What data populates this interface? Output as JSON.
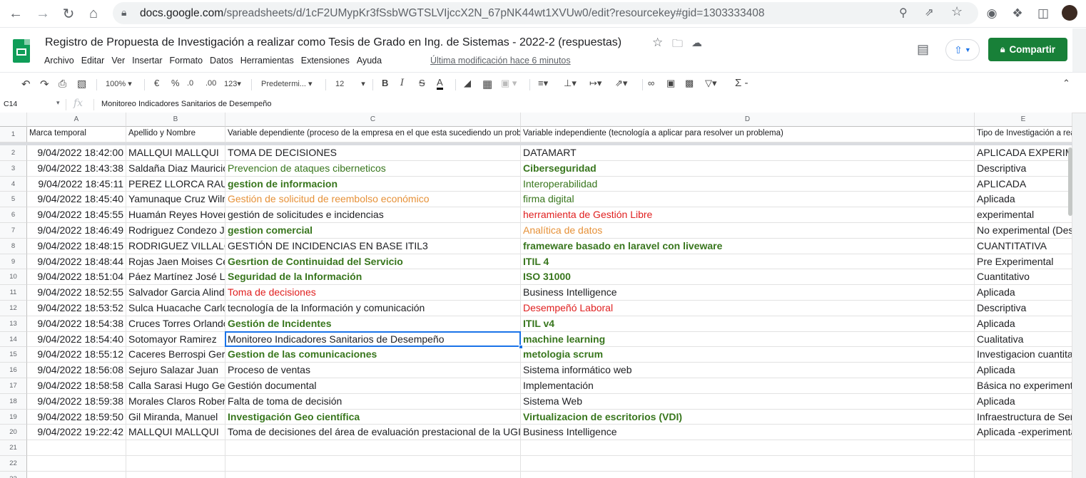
{
  "browser": {
    "url_host": "docs.google.com",
    "url_path": "/spreadsheets/d/1cF2UMypKr3fSsbWGTSLVIjccX2N_67pNK44wt1XVUw0/",
    "url_tail": "edit?resourcekey#gid=1303333408"
  },
  "doc": {
    "title": "Registro de Propuesta de Investigación a realizar como Tesis de Grado en Ing. de Sistemas - 2022-2 (respuestas)",
    "menu": [
      "Archivo",
      "Editar",
      "Ver",
      "Insertar",
      "Formato",
      "Datos",
      "Herramientas",
      "Extensiones",
      "Ayuda"
    ],
    "last_edit": "Última modificación hace 6 minutos",
    "share_label": "Compartir"
  },
  "toolbar": {
    "zoom": "100%",
    "currency": "€",
    "percent": "%",
    "dec_less": ".0",
    "dec_more": ".00",
    "format_more": "123",
    "font": "Predetermi...",
    "font_size": "12",
    "bold": "B",
    "italic": "I",
    "strike": "S",
    "text_color": "A",
    "sum": "Σ"
  },
  "formula": {
    "cell_ref": "C14",
    "fx": "fx",
    "content": "Monitoreo  Indicadores Sanitarios de Desempeño"
  },
  "columns": [
    "A",
    "B",
    "C",
    "D",
    "E"
  ],
  "header_row": [
    "Marca temporal",
    "Apellido y Nombre",
    "Variable dependiente (proceso de la empresa en el que esta sucediendo un problema)",
    "Variable independiente (tecnología a aplicar para resolver un problema)",
    "Tipo de Investigación a realizar"
  ],
  "rows": [
    {
      "n": "2",
      "a": "9/04/2022 18:42:00",
      "b": "MALLQUI MALLQUI",
      "c": "TOMA DE DECISIONES",
      "cs": "",
      "d": "DATAMART",
      "ds": "",
      "e": "APLICADA EXPERIMENTAL"
    },
    {
      "n": "3",
      "a": "9/04/2022 18:43:38",
      "b": "Saldaña Diaz Mauricio",
      "c": "Prevencion de ataques ciberneticos",
      "cs": "greenN",
      "d": "Ciberseguridad",
      "ds": "green",
      "e": "Descriptiva"
    },
    {
      "n": "4",
      "a": "9/04/2022 18:45:11",
      "b": "PEREZ LLORCA RAUL",
      "c": "gestion de informacion",
      "cs": "green",
      "d": "Interoperabilidad",
      "ds": "greenN",
      "e": "APLICADA"
    },
    {
      "n": "5",
      "a": "9/04/2022 18:45:40",
      "b": "Yamunaque Cruz Wilmer",
      "c": "Gestión de solicitud de reembolso económico",
      "cs": "orange",
      "d": "firma digital",
      "ds": "greenN",
      "e": "Aplicada"
    },
    {
      "n": "6",
      "a": "9/04/2022 18:45:55",
      "b": "Huamán Reyes Hover",
      "c": "gestión de solicitudes e incidencias",
      "cs": "",
      "d": "herramienta de Gestión Libre",
      "ds": "red",
      "e": "experimental"
    },
    {
      "n": "7",
      "a": "9/04/2022 18:46:49",
      "b": "Rodriguez Condezo Jose",
      "c": "gestion comercial",
      "cs": "green",
      "d": "Analítica de datos",
      "ds": "orange",
      "e": "No experimental (Descriptiva)"
    },
    {
      "n": "8",
      "a": "9/04/2022 18:48:15",
      "b": "RODRIGUEZ VILLALOBOS",
      "c": "GESTIÓN DE INCIDENCIAS EN BASE ITIL3",
      "cs": "",
      "d": "frameware basado en laravel con liveware",
      "ds": "green",
      "e": "CUANTITATIVA"
    },
    {
      "n": "9",
      "a": "9/04/2022 18:48:44",
      "b": "Rojas Jaen Moises Cesar",
      "c": "Gesrtion de Continuidad del Servicio",
      "cs": "green",
      "d": "ITIL 4",
      "ds": "green",
      "e": "Pre Experimental"
    },
    {
      "n": "10",
      "a": "9/04/2022 18:51:04",
      "b": "Páez Martínez José Luis",
      "c": "Seguridad de la Información",
      "cs": "green",
      "d": "ISO 31000",
      "ds": "green",
      "e": "Cuantitativo"
    },
    {
      "n": "11",
      "a": "9/04/2022 18:52:55",
      "b": "Salvador Garcia Alindor",
      "c": "Toma de decisiones",
      "cs": "red",
      "d": "Business Intelligence",
      "ds": "",
      "e": "Aplicada"
    },
    {
      "n": "12",
      "a": "9/04/2022 18:53:52",
      "b": "Sulca Huacache Carlos",
      "c": "tecnología de la Información y comunicación",
      "cs": "",
      "d": "Desempeñó Laboral",
      "ds": "red",
      "e": "Descriptiva"
    },
    {
      "n": "13",
      "a": "9/04/2022 18:54:38",
      "b": "Cruces Torres Orlando",
      "c": "Gestión de Incidentes",
      "cs": "green",
      "d": "ITIL v4",
      "ds": "green",
      "e": "Aplicada"
    },
    {
      "n": "14",
      "a": "9/04/2022 18:54:40",
      "b": "Sotomayor Ramirez",
      "c": "Monitoreo  Indicadores Sanitarios de Desempeño",
      "cs": "",
      "d": "machine learning",
      "ds": "green",
      "e": "Cualitativa"
    },
    {
      "n": "15",
      "a": "9/04/2022 18:55:12",
      "b": "Caceres Berrospi Gerson",
      "c": "Gestion de las comunicaciones",
      "cs": "green",
      "d": "metologia scrum",
      "ds": "green",
      "e": "Investigacion cuantitativa"
    },
    {
      "n": "16",
      "a": "9/04/2022 18:56:08",
      "b": "Sejuro Salazar Juan",
      "c": "Proceso de ventas",
      "cs": "",
      "d": "Sistema informático web",
      "ds": "",
      "e": "Aplicada"
    },
    {
      "n": "17",
      "a": "9/04/2022 18:58:58",
      "b": "Calla Sarasi Hugo Gerson",
      "c": "Gestión documental",
      "cs": "",
      "d": "Implementación",
      "ds": "",
      "e": "Básica no experimental"
    },
    {
      "n": "18",
      "a": "9/04/2022 18:59:38",
      "b": "Morales Claros Roberto",
      "c": "Falta de toma de decisión",
      "cs": "",
      "d": "Sistema Web",
      "ds": "",
      "e": "Aplicada"
    },
    {
      "n": "19",
      "a": "9/04/2022 18:59:50",
      "b": "Gil Miranda, Manuel",
      "c": "Investigación Geo científica",
      "cs": "green",
      "d": "Virtualizacion de escritorios (VDI)",
      "ds": "green",
      "e": "Infraestructura de Servicios"
    },
    {
      "n": "20",
      "a": "9/04/2022 19:22:42",
      "b": "MALLQUI MALLQUI",
      "c": "Toma de decisiones del área de evaluación prestacional de la UGIPRESS",
      "cs": "",
      "d": "Business Intelligence",
      "ds": "",
      "e": "Aplicada -experimental"
    }
  ],
  "empty_rows": [
    "21",
    "22",
    "23"
  ],
  "icons": {
    "back": "back-arrow-icon",
    "forward": "forward-arrow-icon",
    "reload": "reload-icon",
    "home": "home-icon",
    "lock": "lock-icon",
    "star": "star-icon",
    "share_page": "share-page-icon",
    "camera": "camera-icon",
    "extensions": "puzzle-icon",
    "sidebar": "sidebar-icon"
  },
  "colors": {
    "green_text": "#38761d",
    "red_text": "#e02020",
    "orange_text": "#e69138",
    "share_bg": "#188038",
    "selection": "#1a73e8"
  }
}
